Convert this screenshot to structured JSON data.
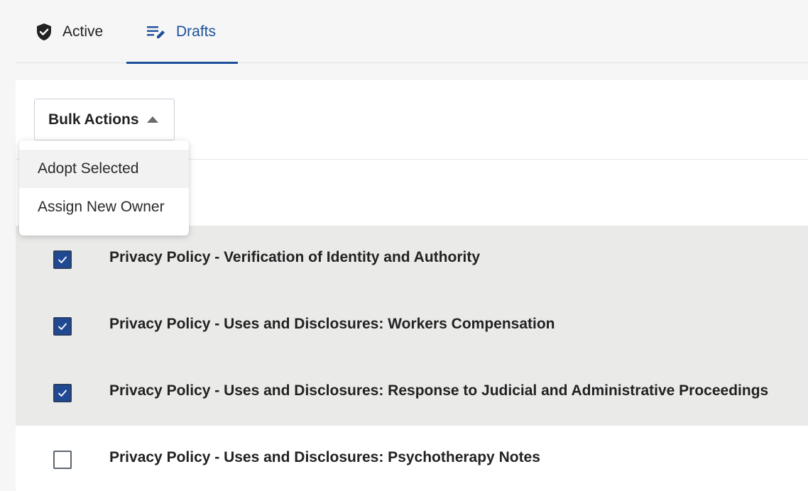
{
  "tabs": [
    {
      "label": "Active",
      "icon": "shield-check-icon"
    },
    {
      "label": "Drafts",
      "icon": "edit-list-icon",
      "selected": true
    }
  ],
  "toolbar": {
    "bulk_actions_label": "Bulk Actions",
    "menu_open": true
  },
  "menu": {
    "items": [
      {
        "label": "Adopt Selected"
      },
      {
        "label": "Assign New Owner"
      }
    ]
  },
  "rows": [
    {
      "title": "Privacy Policy - Verification of Identity and Authority",
      "checked": true
    },
    {
      "title": "Privacy Policy - Uses and Disclosures: Workers Compensation",
      "checked": true
    },
    {
      "title": "Privacy Policy - Uses and Disclosures: Response to Judicial and Administrative Proceedings",
      "checked": true
    },
    {
      "title": "Privacy Policy - Uses and Disclosures: Psychotherapy Notes",
      "checked": false
    }
  ],
  "colors": {
    "accent": "#1d4f9c",
    "checkbox_checked": "#1f4a93",
    "selected_row": "#eaeae9"
  }
}
